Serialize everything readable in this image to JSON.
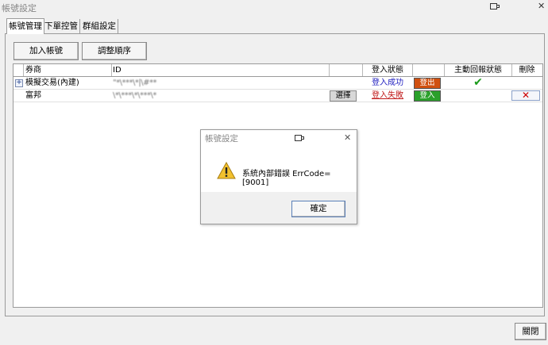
{
  "window": {
    "title": "帳號設定",
    "icons": [
      "restore-window-icon",
      "close-icon"
    ],
    "close_glyph": "✕"
  },
  "tabs": [
    {
      "label": "帳號管理",
      "active": true
    },
    {
      "label": "下單控管",
      "active": false
    },
    {
      "label": "群組設定",
      "active": false
    }
  ],
  "toolbar": {
    "add_account_label": "加入帳號",
    "reorder_label": "調整順序"
  },
  "table": {
    "headers": [
      "券商",
      "ID",
      "",
      "登入狀態",
      "",
      "主動回報狀態",
      "刪除"
    ],
    "rows": [
      {
        "expand_glyph": "+",
        "broker": "模擬交易(內建)",
        "id": "\"*\\***\\*|\\#**",
        "select_label": "",
        "login_status": "登入成功",
        "login_status_color": "#2020c0",
        "action_label": "登出",
        "action_color": "#d05010",
        "report_status_glyph": "✔",
        "report_status_color": "#1a9a1a",
        "delete_glyph": ""
      },
      {
        "expand_glyph": "",
        "broker": "富邦",
        "id": "\\*\\***\\*\\***\\*",
        "select_label": "選擇",
        "login_status": "登入失敗",
        "login_status_color": "#c01818",
        "action_label": "登入",
        "action_color": "#2aa02a",
        "report_status_glyph": "",
        "report_status_color": "",
        "delete_glyph": "✕"
      }
    ]
  },
  "dialog": {
    "title": "帳號設定",
    "message": "系統內部錯誤 ErrCode=[9001]",
    "ok_label": "確定",
    "icon": "warning-icon",
    "close_glyph": "✕"
  },
  "footer": {
    "close_label": "關閉"
  }
}
